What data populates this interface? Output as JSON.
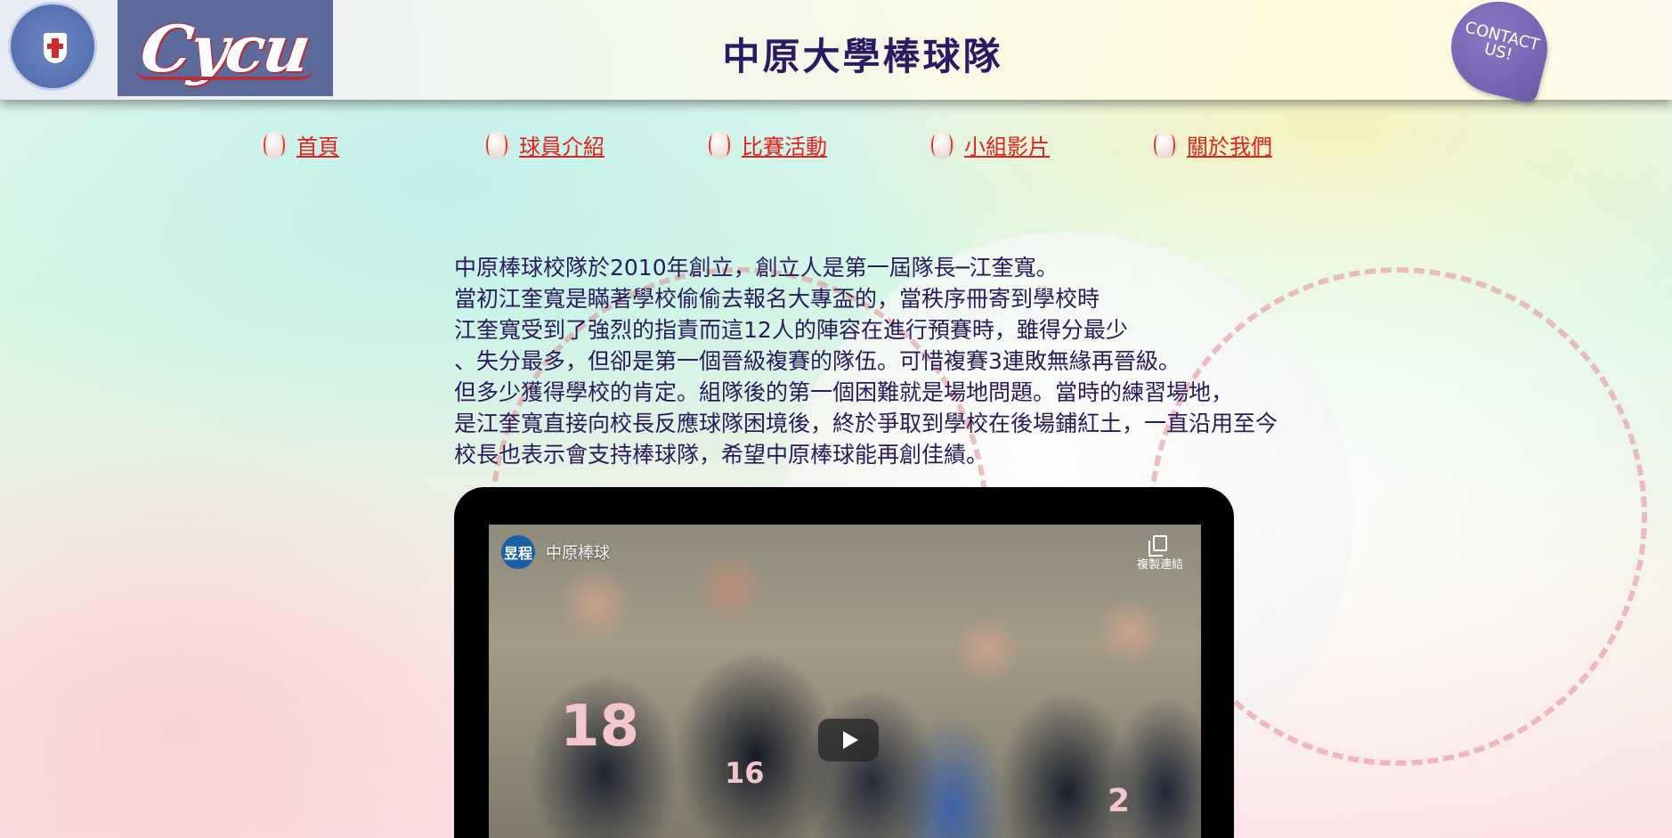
{
  "header": {
    "site_title": "中原大學棒球隊",
    "logo_text": "Cycu",
    "contact_line1": "CONTACT",
    "contact_line2": "US!"
  },
  "nav": {
    "items": [
      {
        "label": "首頁"
      },
      {
        "label": "球員介紹"
      },
      {
        "label": "比賽活動"
      },
      {
        "label": "小組影片"
      },
      {
        "label": "關於我們"
      }
    ]
  },
  "intro": {
    "lines": [
      "中原棒球校隊於2010年創立，創立人是第一屆隊長─江奎寬。",
      "當初江奎寬是瞞著學校偷偷去報名大專盃的，當秩序冊寄到學校時",
      "江奎寬受到了強烈的指責而這12人的陣容在進行預賽時，雖得分最少",
      "、失分最多，但卻是第一個晉級複賽的隊伍。可惜複賽3連敗無緣再晉級。",
      "但多少獲得學校的肯定。組隊後的第一個困難就是場地問題。當時的練習場地，",
      "是江奎寬直接向校長反應球隊困境後，終於爭取到學校在後場鋪紅土，一直沿用至今",
      "校長也表示會支持棒球隊，希望中原棒球能再創佳績。"
    ]
  },
  "video": {
    "channel_avatar": "昱程",
    "channel_name": "中原棒球",
    "copy_link_label": "複製連結",
    "jersey_numbers": [
      "18",
      "16",
      "2"
    ]
  },
  "colors": {
    "title": "#2b1a63",
    "nav_link": "#e3231b",
    "body_text": "#2a1a5e",
    "contact_badge": "#6b5aa8"
  }
}
